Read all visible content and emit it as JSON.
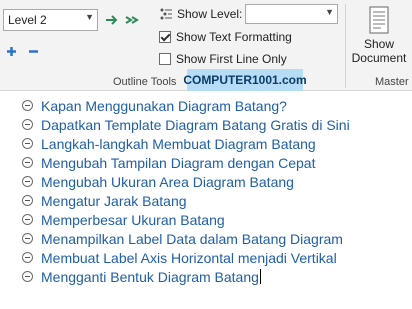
{
  "ribbon": {
    "level_value": "Level 2",
    "show_level_label": "Show Level:",
    "show_text_formatting_label": "Show Text Formatting",
    "show_first_line_only_label": "Show First Line Only",
    "show_text_formatting_checked": true,
    "show_first_line_only_checked": false,
    "group_label": "Outline Tools",
    "watermark": "COMPUTER1001.com",
    "show_document_line1": "Show",
    "show_document_line2": "Document",
    "master_label": "Master"
  },
  "outline": {
    "items": [
      "Kapan Menggunakan Diagram Batang?",
      "Dapatkan Template Diagram Batang Gratis di Sini",
      "Langkah-langkah Membuat Diagram Batang",
      "Mengubah Tampilan Diagram dengan Cepat",
      "Mengubah Ukuran Area Diagram Batang",
      "Mengatur Jarak Batang",
      "Memperbesar Ukuran Batang",
      "Menampilkan Label Data dalam Batang Diagram",
      "Membuat Label Axis Horizontal menjadi Vertikal",
      "Mengganti Bentuk Diagram Batang"
    ]
  },
  "colors": {
    "accent_green": "#2e8b57",
    "outline_text": "#1f5fa8",
    "add_blue": "#2b73c6"
  }
}
